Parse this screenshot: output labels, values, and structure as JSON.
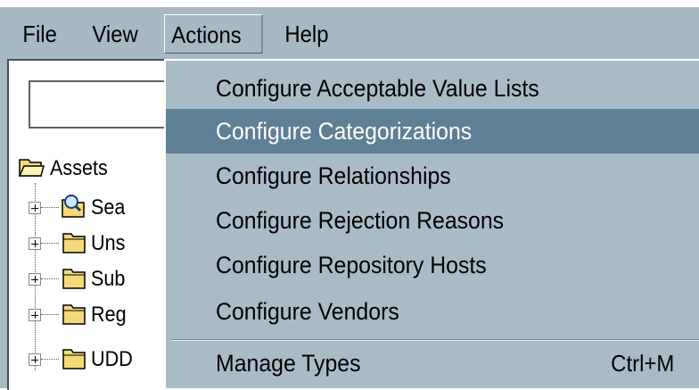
{
  "menubar": {
    "file": "File",
    "view": "View",
    "actions": "Actions",
    "help": "Help"
  },
  "tree": {
    "root": "Assets",
    "rows": [
      "Sea",
      "Uns",
      "Sub",
      "Reg",
      "UDD"
    ]
  },
  "actions_menu": {
    "items": [
      "Configure Acceptable Value Lists",
      "Configure Categorizations",
      "Configure Relationships",
      "Configure Rejection Reasons",
      "Configure Repository Hosts",
      "Configure Vendors"
    ],
    "selected": "Configure Categorizations",
    "manage_types": "Manage Types",
    "manage_types_shortcut": "Ctrl+M"
  },
  "colors": {
    "menubar": "#a7bac4",
    "highlight": "#5f7f95",
    "folder": "#f3d97a"
  }
}
